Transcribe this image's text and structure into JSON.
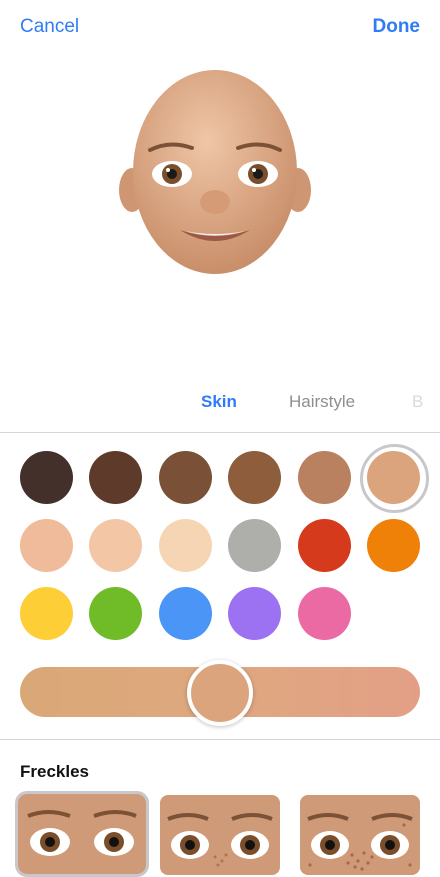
{
  "nav": {
    "cancel_label": "Cancel",
    "done_label": "Done"
  },
  "tabs": [
    {
      "label": "Skin",
      "active": true
    },
    {
      "label": "Hairstyle",
      "active": false
    },
    {
      "label": "B",
      "active": false
    }
  ],
  "skin": {
    "swatches": [
      "#43302a",
      "#5e3a2b",
      "#7a5136",
      "#8e5d3c",
      "#b98160",
      "#dca47c",
      "#efbb9a",
      "#f3c7a6",
      "#f6d5b4",
      "#aeaeab",
      "#d63a1c",
      "#ef8008",
      "#fece37",
      "#70bc28",
      "#4b95f7",
      "#9d72f2",
      "#ec6aa4"
    ],
    "selected_index": 5,
    "slider_color": "#dca47c",
    "slider_position": 0.5
  },
  "freckles": {
    "title": "Freckles",
    "options": [
      "none",
      "light",
      "heavy"
    ],
    "selected_index": 0
  },
  "colors": {
    "accent": "#2f7cf6"
  }
}
